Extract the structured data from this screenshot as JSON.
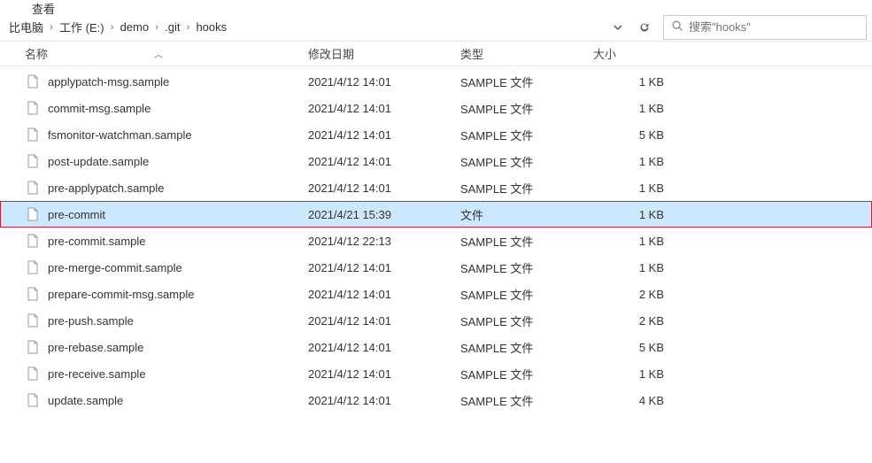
{
  "title": "查看",
  "breadcrumb": [
    "比电脑",
    "工作 (E:)",
    "demo",
    ".git",
    "hooks"
  ],
  "search": {
    "placeholder": "搜索\"hooks\""
  },
  "columns": {
    "name": "名称",
    "date": "修改日期",
    "type": "类型",
    "size": "大小"
  },
  "files": [
    {
      "name": "applypatch-msg.sample",
      "date": "2021/4/12 14:01",
      "type": "SAMPLE 文件",
      "size": "1 KB",
      "selected": false,
      "highlighted": false
    },
    {
      "name": "commit-msg.sample",
      "date": "2021/4/12 14:01",
      "type": "SAMPLE 文件",
      "size": "1 KB",
      "selected": false,
      "highlighted": false
    },
    {
      "name": "fsmonitor-watchman.sample",
      "date": "2021/4/12 14:01",
      "type": "SAMPLE 文件",
      "size": "5 KB",
      "selected": false,
      "highlighted": false
    },
    {
      "name": "post-update.sample",
      "date": "2021/4/12 14:01",
      "type": "SAMPLE 文件",
      "size": "1 KB",
      "selected": false,
      "highlighted": false
    },
    {
      "name": "pre-applypatch.sample",
      "date": "2021/4/12 14:01",
      "type": "SAMPLE 文件",
      "size": "1 KB",
      "selected": false,
      "highlighted": false
    },
    {
      "name": "pre-commit",
      "date": "2021/4/21 15:39",
      "type": "文件",
      "size": "1 KB",
      "selected": true,
      "highlighted": true
    },
    {
      "name": "pre-commit.sample",
      "date": "2021/4/12 22:13",
      "type": "SAMPLE 文件",
      "size": "1 KB",
      "selected": false,
      "highlighted": false
    },
    {
      "name": "pre-merge-commit.sample",
      "date": "2021/4/12 14:01",
      "type": "SAMPLE 文件",
      "size": "1 KB",
      "selected": false,
      "highlighted": false
    },
    {
      "name": "prepare-commit-msg.sample",
      "date": "2021/4/12 14:01",
      "type": "SAMPLE 文件",
      "size": "2 KB",
      "selected": false,
      "highlighted": false
    },
    {
      "name": "pre-push.sample",
      "date": "2021/4/12 14:01",
      "type": "SAMPLE 文件",
      "size": "2 KB",
      "selected": false,
      "highlighted": false
    },
    {
      "name": "pre-rebase.sample",
      "date": "2021/4/12 14:01",
      "type": "SAMPLE 文件",
      "size": "5 KB",
      "selected": false,
      "highlighted": false
    },
    {
      "name": "pre-receive.sample",
      "date": "2021/4/12 14:01",
      "type": "SAMPLE 文件",
      "size": "1 KB",
      "selected": false,
      "highlighted": false
    },
    {
      "name": "update.sample",
      "date": "2021/4/12 14:01",
      "type": "SAMPLE 文件",
      "size": "4 KB",
      "selected": false,
      "highlighted": false
    }
  ]
}
